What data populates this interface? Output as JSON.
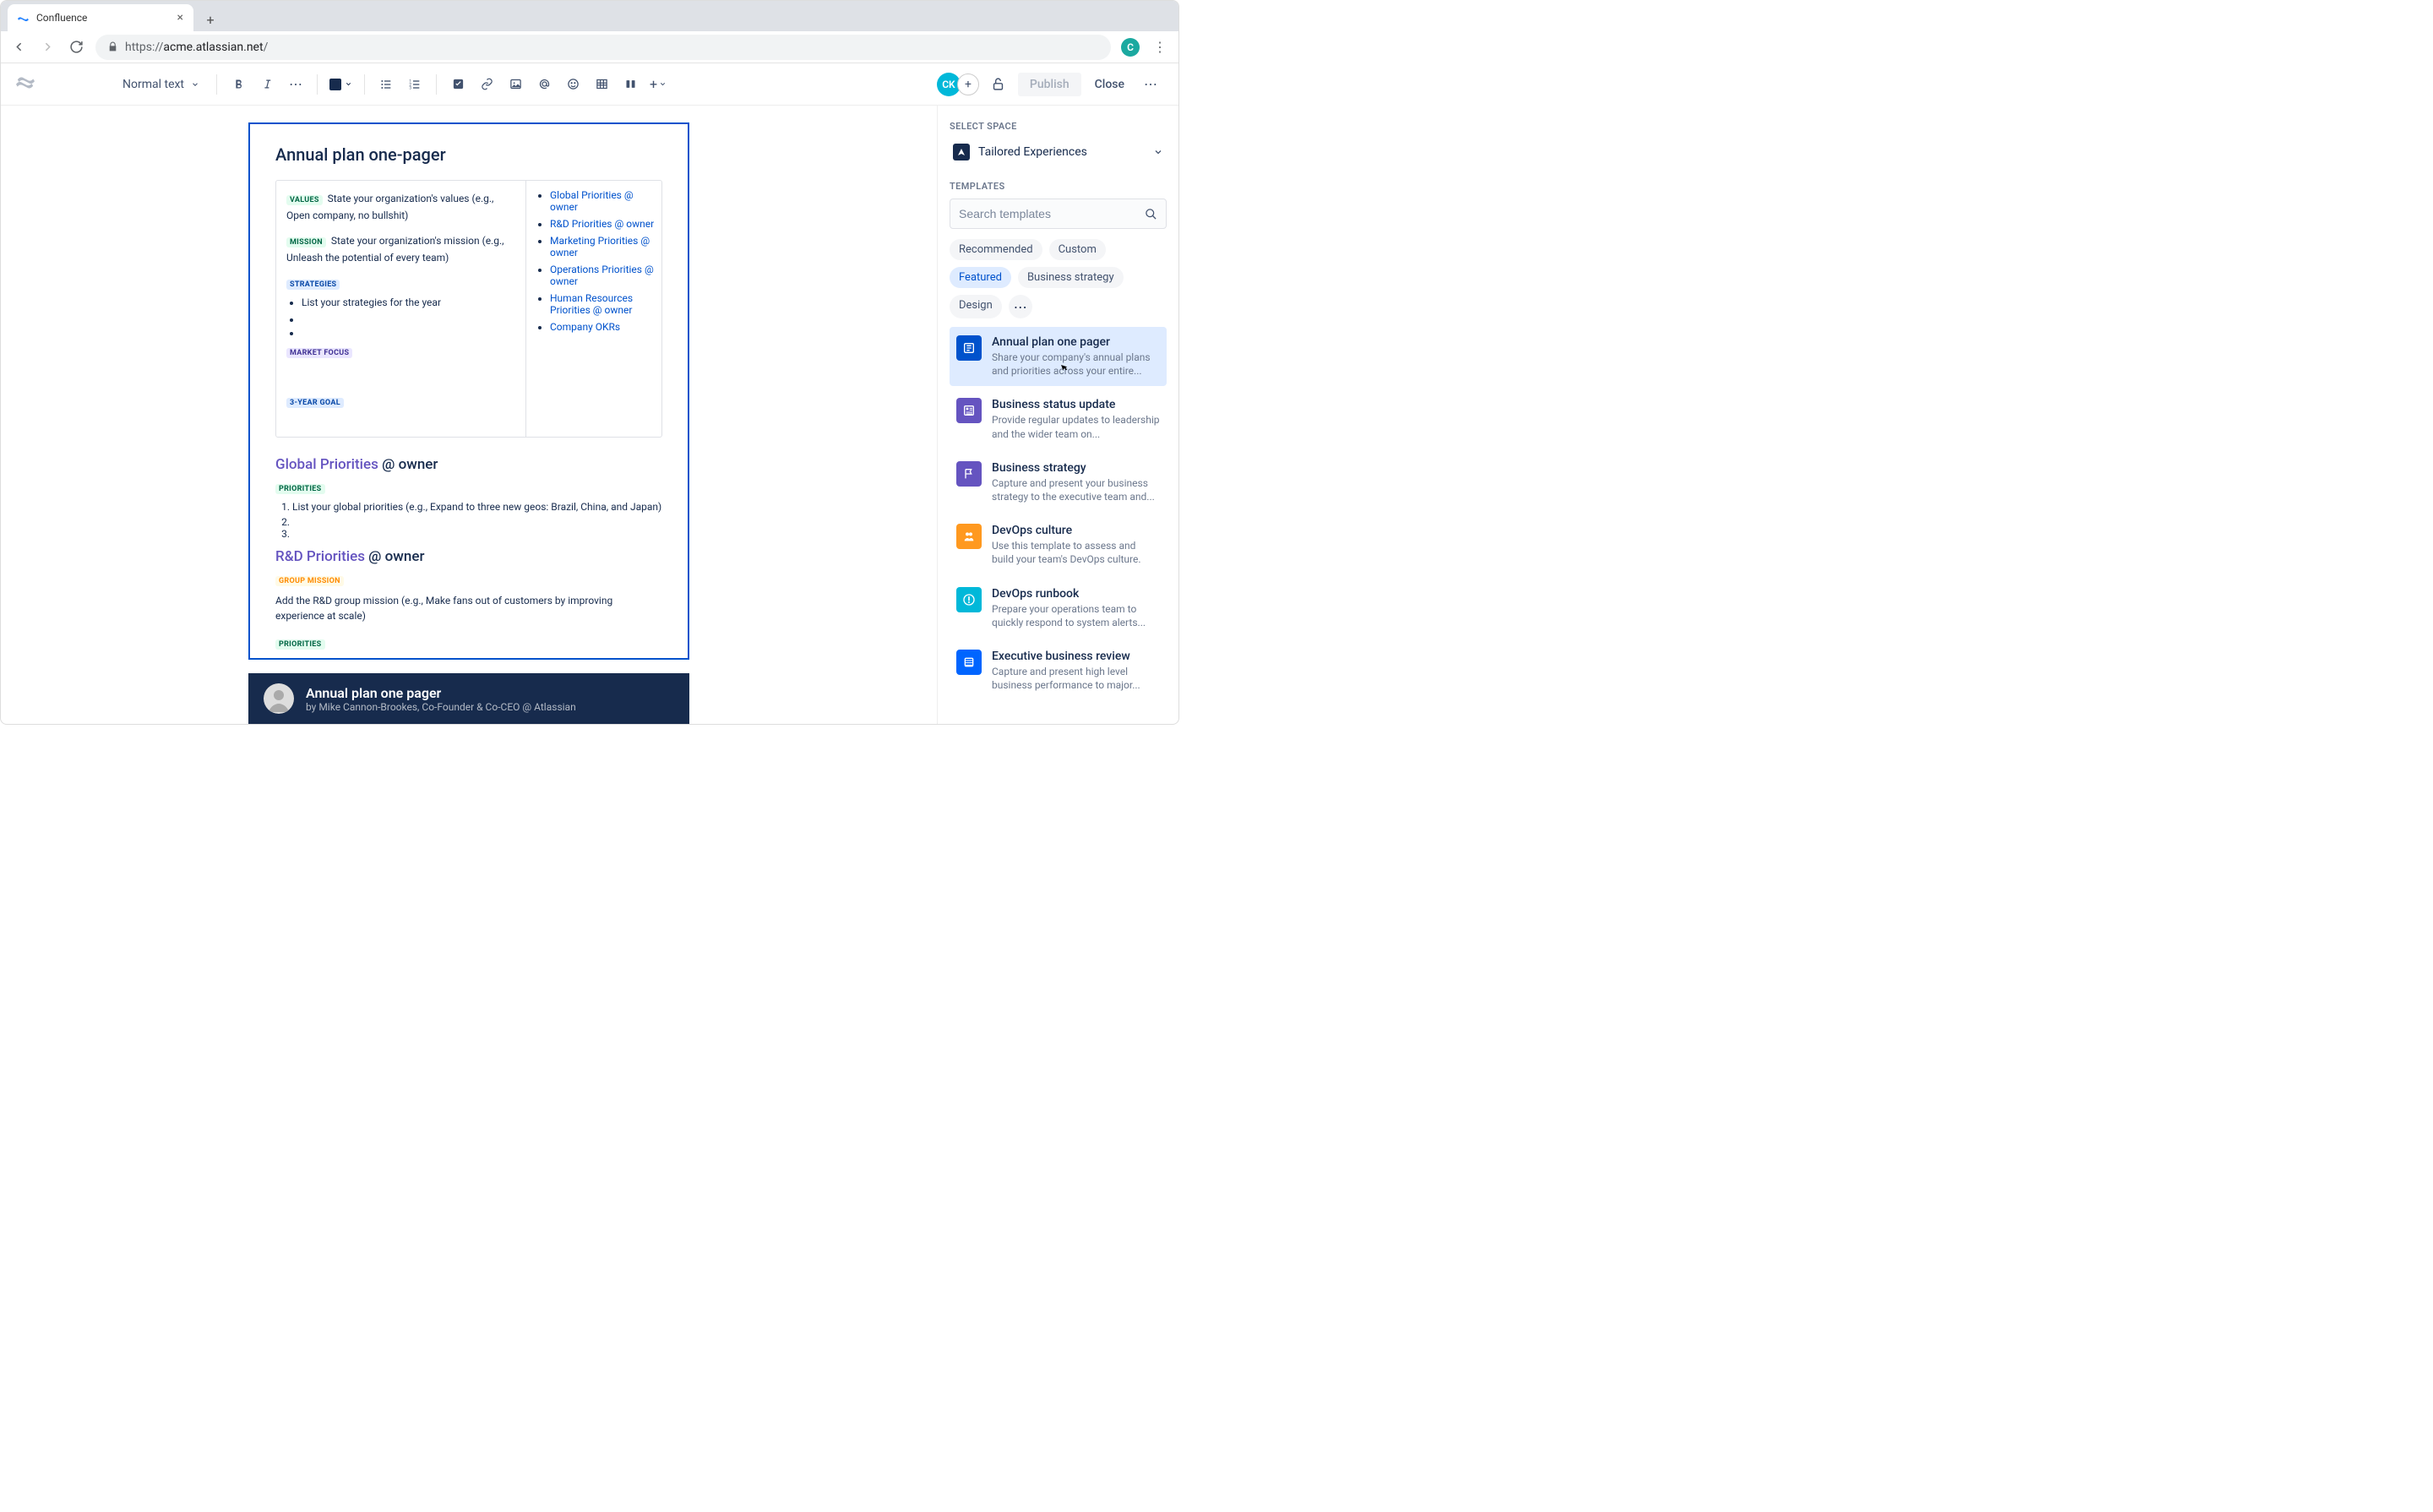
{
  "browser": {
    "tab_title": "Confluence",
    "url_prefix": "https://",
    "url_host": "acme.atlassian.net",
    "url_path": "/",
    "profile_initial": "C"
  },
  "toolbar": {
    "text_style": "Normal text",
    "publish": "Publish",
    "close": "Close",
    "avatar_initials": "CK"
  },
  "page": {
    "title": "Annual plan one-pager",
    "values_tag": "VALUES",
    "values_text": "State your organization's values (e.g., Open company, no bullshit)",
    "mission_tag": "MISSION",
    "mission_text": "State your organization's mission (e.g., Unleash the potential of every team)",
    "strategies_tag": "STRATEGIES",
    "strategies_bullet": "List your strategies for the year",
    "market_focus_tag": "MARKET FOCUS",
    "three_year_tag": "3-YEAR GOAL",
    "toc": [
      "Global Priorities @ owner",
      "R&D Priorities @ owner",
      "Marketing Priorities @ owner",
      "Operations Priorities @ owner",
      "Human Resources Priorities @ owner",
      "Company OKRs"
    ],
    "sec1_link": "Global Priorities",
    "sec1_owner": " @ owner",
    "sec1_tag": "PRIORITIES",
    "sec1_item": "List your global priorities (e.g., Expand to three new geos: Brazil, China, and Japan)",
    "sec2_link": "R&D Priorities",
    "sec2_owner": " @ owner",
    "sec2_tag": "GROUP MISSION",
    "sec2_text": "Add the R&D group mission (e.g., Make fans out of customers by improving experience at scale)",
    "sec2_tag2": "PRIORITIES"
  },
  "footer": {
    "title": "Annual plan one pager",
    "byline": "by Mike Cannon-Brookes, Co-Founder & Co-CEO @ Atlassian"
  },
  "panel": {
    "select_space_label": "SELECT SPACE",
    "space_name": "Tailored Experiences",
    "templates_label": "TEMPLATES",
    "search_placeholder": "Search templates",
    "pills": {
      "recommended": "Recommended",
      "custom": "Custom",
      "featured": "Featured",
      "business_strategy": "Business strategy",
      "design": "Design"
    },
    "templates": [
      {
        "title": "Annual plan one pager",
        "desc": "Share your company's annual plans and priorities across your entire...",
        "color": "#0052CC"
      },
      {
        "title": "Business status update",
        "desc": "Provide regular updates to leadership and the wider team on...",
        "color": "#6554C0"
      },
      {
        "title": "Business strategy",
        "desc": "Capture and present your business strategy to the executive team and...",
        "color": "#6554C0"
      },
      {
        "title": "DevOps culture",
        "desc": "Use this template to assess and build your team's DevOps culture.",
        "color": "#FF991F"
      },
      {
        "title": "DevOps runbook",
        "desc": "Prepare your operations team to quickly respond to system alerts...",
        "color": "#00B8D9"
      },
      {
        "title": "Executive business review",
        "desc": "Capture and present high level business performance to major...",
        "color": "#0065FF"
      }
    ]
  }
}
